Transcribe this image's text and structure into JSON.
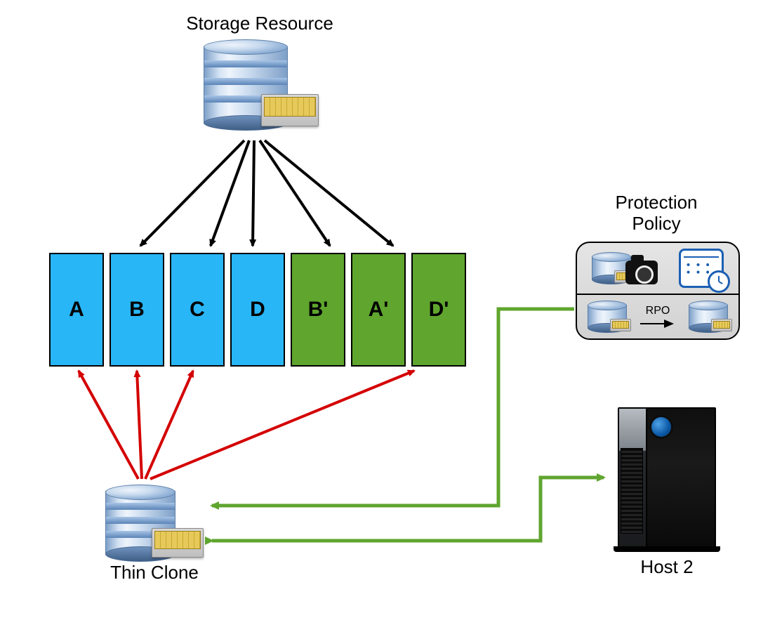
{
  "labels": {
    "storage_resource": "Storage Resource",
    "protection_policy_line1": "Protection",
    "protection_policy_line2": "Policy",
    "rpo": "RPO",
    "host2": "Host 2",
    "thin_clone": "Thin Clone"
  },
  "blocks": [
    {
      "label": "A",
      "color": "blue"
    },
    {
      "label": "B",
      "color": "blue"
    },
    {
      "label": "C",
      "color": "blue"
    },
    {
      "label": "D",
      "color": "blue"
    },
    {
      "label": "B'",
      "color": "green"
    },
    {
      "label": "A'",
      "color": "green"
    },
    {
      "label": "D'",
      "color": "green"
    }
  ],
  "colors": {
    "block_blue": "#29b6f6",
    "block_green": "#5fa52e",
    "arrow_black": "#000000",
    "arrow_red": "#d40000",
    "arrow_green": "#5fa52e"
  },
  "arrows": {
    "description": "Black arrows from Storage Resource to blue blocks and green area; red arrows from Thin Clone to A, B, C and D'; green connectors from Protection Policy and Host 2 to Thin Clone."
  }
}
